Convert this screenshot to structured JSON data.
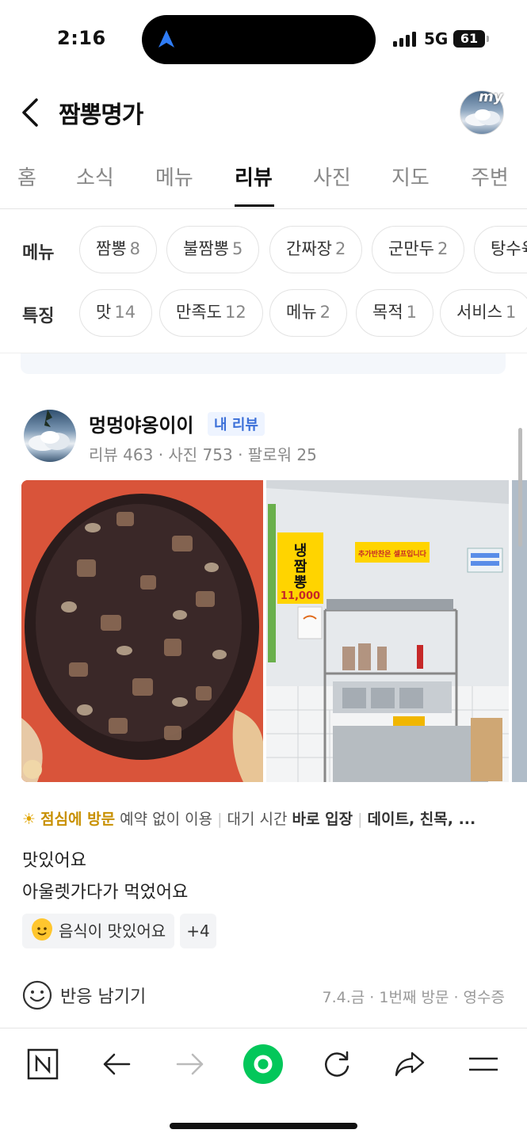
{
  "status": {
    "time": "2:16",
    "network": "5G",
    "battery": "61"
  },
  "header": {
    "title": "짬뽕명가",
    "avatar_badge": "my"
  },
  "tabs": [
    "홈",
    "소식",
    "메뉴",
    "리뷰",
    "사진",
    "지도",
    "주변"
  ],
  "active_tab": "리뷰",
  "menu_filter": {
    "label": "메뉴",
    "chips": [
      {
        "name": "짬뽕",
        "count": "8"
      },
      {
        "name": "불짬뽕",
        "count": "5"
      },
      {
        "name": "간짜장",
        "count": "2"
      },
      {
        "name": "군만두",
        "count": "2"
      },
      {
        "name": "탕수육",
        "count": ""
      }
    ]
  },
  "feature_filter": {
    "label": "특징",
    "chips": [
      {
        "name": "맛",
        "count": "14"
      },
      {
        "name": "만족도",
        "count": "12"
      },
      {
        "name": "메뉴",
        "count": "2"
      },
      {
        "name": "목적",
        "count": "1"
      },
      {
        "name": "서비스",
        "count": "1"
      }
    ]
  },
  "review": {
    "author": "멍멍야옹이이",
    "my_review_badge": "내 리뷰",
    "stats": "리뷰 463 · 사진 753 · 팔로워 25",
    "photo_sign": {
      "line1": "냉",
      "line2": "짬",
      "line3": "뽕",
      "price": "11,000"
    },
    "photo_banner": "추가반찬은 셀프입니다",
    "visit": {
      "time": "점심에 방문",
      "reservation": "예약 없이 이용",
      "wait_label": "대기 시간",
      "wait_value": "바로 입장",
      "purpose": "데이트, 친목, ..."
    },
    "text_line1": "맛있어요",
    "text_line2": "아울렛가다가 먹었어요",
    "keyword": "음식이 맛있어요",
    "more_keywords": "+4",
    "react_label": "반응 남기기",
    "meta": "7.4.금 · 1번째 방문 · 영수증"
  },
  "toolbar": [
    "naver-home",
    "back",
    "forward",
    "green-dot",
    "refresh",
    "share",
    "menu"
  ],
  "colors": {
    "accent_green": "#03c75a",
    "link_blue": "#3b6fd8",
    "lunch_gold": "#c89000"
  }
}
